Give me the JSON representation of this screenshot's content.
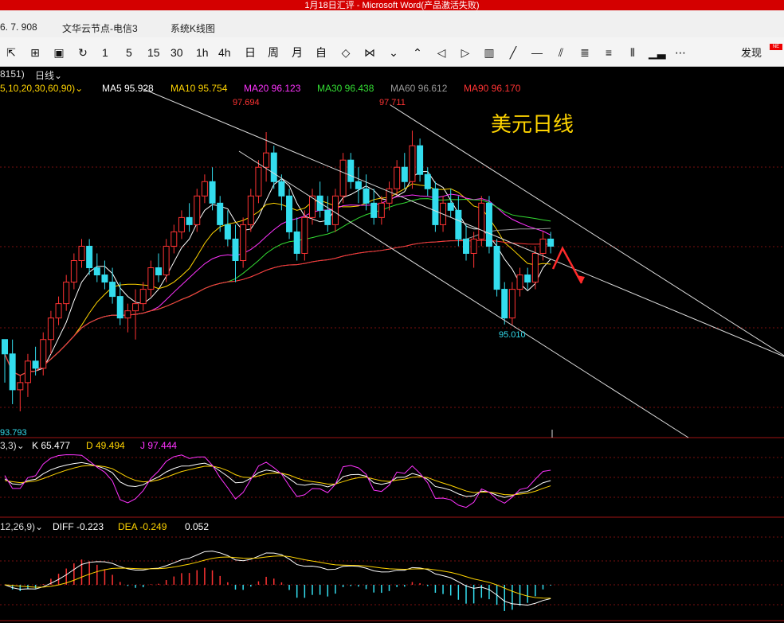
{
  "window": {
    "title": "1月18日汇评 - Microsoft Word(产品激活失败)"
  },
  "tabs": [
    {
      "label": "6. 7. 908"
    },
    {
      "label": "文华云节点-电信3"
    },
    {
      "label": "系统K线图"
    }
  ],
  "toolbar": {
    "periods": [
      "1",
      "5",
      "15",
      "30",
      "1h",
      "4h",
      "日",
      "周",
      "月",
      "自"
    ],
    "find_label": "发现",
    "badge": "NE"
  },
  "main_legend": {
    "params": "5,10,20,30,60,90)",
    "code": "8151)",
    "period": "日线",
    "ma5": "MA5 95.928",
    "ma10": "MA10 95.754",
    "ma20": "MA20 96.123",
    "ma30": "MA30 96.438",
    "ma60": "MA60 96.612",
    "ma90": "MA90 96.170",
    "colors": {
      "ma5": "#ffffff",
      "ma10": "#ffd400",
      "ma20": "#ff33ff",
      "ma30": "#33dd33",
      "ma60": "#999999",
      "ma90": "#ff3333"
    }
  },
  "kdj_legend": {
    "params": "3,3)",
    "k": "K 65.477",
    "d": "D 49.494",
    "j": "J 97.444"
  },
  "macd_legend": {
    "params": "12,26,9)",
    "diff": "DIFF -0.223",
    "dea": "DEA -0.249",
    "macd": "0.052"
  },
  "annotations": {
    "title": "美元日线",
    "high1": "97.694",
    "high2": "97.711",
    "low": "95.010",
    "left_low": "93.793"
  },
  "chart_data": {
    "type": "candlestick",
    "title": "美元日线",
    "ylim": [
      93.6,
      98.2
    ],
    "up_color": "#ff3333",
    "down_color": "#33ddee",
    "candles": [
      [
        94.8,
        94.8,
        94.2,
        94.6
      ],
      [
        94.6,
        94.8,
        93.9,
        94.1
      ],
      [
        94.1,
        94.3,
        93.8,
        94.2
      ],
      [
        94.2,
        94.6,
        94.0,
        94.5
      ],
      [
        94.5,
        94.7,
        94.3,
        94.4
      ],
      [
        94.4,
        94.9,
        94.3,
        94.8
      ],
      [
        94.8,
        95.2,
        94.6,
        95.1
      ],
      [
        95.1,
        95.4,
        95.0,
        95.3
      ],
      [
        95.3,
        95.7,
        95.2,
        95.6
      ],
      [
        95.6,
        96.0,
        95.5,
        95.9
      ],
      [
        95.9,
        96.2,
        95.8,
        96.1
      ],
      [
        96.1,
        96.2,
        95.7,
        95.8
      ],
      [
        95.8,
        96.0,
        95.6,
        95.7
      ],
      [
        95.7,
        95.9,
        95.5,
        95.6
      ],
      [
        95.6,
        95.8,
        95.3,
        95.4
      ],
      [
        95.4,
        95.6,
        95.0,
        95.1
      ],
      [
        95.1,
        95.3,
        94.9,
        95.2
      ],
      [
        95.2,
        95.5,
        94.8,
        95.3
      ],
      [
        95.3,
        95.6,
        95.2,
        95.5
      ],
      [
        95.5,
        95.9,
        95.4,
        95.8
      ],
      [
        95.8,
        96.0,
        95.6,
        95.7
      ],
      [
        95.7,
        96.2,
        95.6,
        96.1
      ],
      [
        96.1,
        96.4,
        96.0,
        96.3
      ],
      [
        96.3,
        96.6,
        96.2,
        96.5
      ],
      [
        96.5,
        96.7,
        96.3,
        96.4
      ],
      [
        96.4,
        96.9,
        96.3,
        96.8
      ],
      [
        96.8,
        97.1,
        96.7,
        97.0
      ],
      [
        97.0,
        97.2,
        96.6,
        96.7
      ],
      [
        96.7,
        96.8,
        96.3,
        96.4
      ],
      [
        96.4,
        96.6,
        96.1,
        96.2
      ],
      [
        96.2,
        96.4,
        95.6,
        95.9
      ],
      [
        95.9,
        96.5,
        95.8,
        96.4
      ],
      [
        96.4,
        96.9,
        96.3,
        96.8
      ],
      [
        96.8,
        97.3,
        96.7,
        97.2
      ],
      [
        97.2,
        97.69,
        97.0,
        97.4
      ],
      [
        97.4,
        97.5,
        96.9,
        97.0
      ],
      [
        97.0,
        97.1,
        96.6,
        96.8
      ],
      [
        96.8,
        96.9,
        96.2,
        96.3
      ],
      [
        96.3,
        96.5,
        95.9,
        96.0
      ],
      [
        96.0,
        96.6,
        95.9,
        96.5
      ],
      [
        96.5,
        96.9,
        96.4,
        96.8
      ],
      [
        96.8,
        97.0,
        96.5,
        96.6
      ],
      [
        96.6,
        96.8,
        96.3,
        96.4
      ],
      [
        96.4,
        96.9,
        96.3,
        96.8
      ],
      [
        96.8,
        97.4,
        96.7,
        97.3
      ],
      [
        97.3,
        97.4,
        96.9,
        97.0
      ],
      [
        97.0,
        97.2,
        96.7,
        96.9
      ],
      [
        96.9,
        97.1,
        96.6,
        96.7
      ],
      [
        96.7,
        96.9,
        96.4,
        96.5
      ],
      [
        96.5,
        96.8,
        96.4,
        96.7
      ],
      [
        96.7,
        97.0,
        96.6,
        96.9
      ],
      [
        96.9,
        97.3,
        96.8,
        97.2
      ],
      [
        97.2,
        97.4,
        96.9,
        97.0
      ],
      [
        97.0,
        97.71,
        96.9,
        97.5
      ],
      [
        97.5,
        97.6,
        97.0,
        97.1
      ],
      [
        97.1,
        97.2,
        96.8,
        96.9
      ],
      [
        96.9,
        97.0,
        96.3,
        96.4
      ],
      [
        96.4,
        96.8,
        96.3,
        96.7
      ],
      [
        96.7,
        96.9,
        96.5,
        96.6
      ],
      [
        96.6,
        96.8,
        96.1,
        96.2
      ],
      [
        96.2,
        96.4,
        95.9,
        96.0
      ],
      [
        96.0,
        96.3,
        95.8,
        96.2
      ],
      [
        96.2,
        96.8,
        96.1,
        96.7
      ],
      [
        96.7,
        96.8,
        96.0,
        96.1
      ],
      [
        96.1,
        96.2,
        95.4,
        95.5
      ],
      [
        95.5,
        95.6,
        95.01,
        95.1
      ],
      [
        95.1,
        95.6,
        95.0,
        95.5
      ],
      [
        95.5,
        95.8,
        95.4,
        95.7
      ],
      [
        95.7,
        95.8,
        95.5,
        95.6
      ],
      [
        95.6,
        96.1,
        95.5,
        96.0
      ],
      [
        96.0,
        96.3,
        95.9,
        96.2
      ],
      [
        96.2,
        96.3,
        96.0,
        96.1
      ]
    ]
  }
}
